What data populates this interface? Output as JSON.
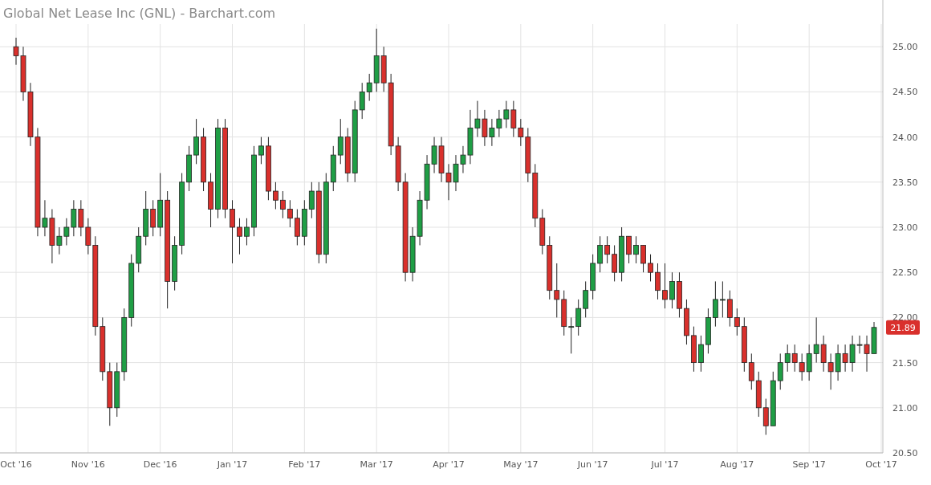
{
  "title": "Global Net Lease Inc (GNL) - Barchart.com",
  "last_price": {
    "label": "21.89",
    "color": "#d9302c"
  },
  "chart_data": {
    "type": "candlestick",
    "grid": true,
    "ylim": [
      20.5,
      25.5
    ],
    "categories": [
      "Oct '16",
      null,
      null,
      null,
      null,
      null,
      null,
      null,
      null,
      null,
      "Nov '16",
      null,
      null,
      null,
      null,
      null,
      null,
      null,
      null,
      null,
      "Dec '16",
      null,
      null,
      null,
      null,
      null,
      null,
      null,
      null,
      null,
      "Jan '17",
      null,
      null,
      null,
      null,
      null,
      null,
      null,
      null,
      null,
      "Feb '17",
      null,
      null,
      null,
      null,
      null,
      null,
      null,
      null,
      null,
      "Mar '17",
      null,
      null,
      null,
      null,
      null,
      null,
      null,
      null,
      null,
      "Apr '17",
      null,
      null,
      null,
      null,
      null,
      null,
      null,
      null,
      null,
      "May '17",
      null,
      null,
      null,
      null,
      null,
      null,
      null,
      null,
      null,
      "Jun '17",
      null,
      null,
      null,
      null,
      null,
      null,
      null,
      null,
      null,
      "Jul '17",
      null,
      null,
      null,
      null,
      null,
      null,
      null,
      null,
      null,
      "Aug '17",
      null,
      null,
      null,
      null,
      null,
      null,
      null,
      null,
      null,
      "Sep '17",
      null,
      null,
      null,
      null,
      null,
      null,
      null,
      null,
      null,
      "Oct '17"
    ],
    "yticks": [
      {
        "value": 20.5,
        "label": "20.50"
      },
      {
        "value": 21,
        "label": "21.00"
      },
      {
        "value": 21.5,
        "label": "21.50"
      },
      {
        "value": 22,
        "label": "22.00"
      },
      {
        "value": 22.5,
        "label": "22.50"
      },
      {
        "value": 23,
        "label": "23.00"
      },
      {
        "value": 23.5,
        "label": "23.50"
      },
      {
        "value": 24,
        "label": "24.00"
      },
      {
        "value": 24.5,
        "label": "24.50"
      },
      {
        "value": 25,
        "label": "25.00"
      }
    ],
    "ohlc": [
      [
        25.0,
        25.1,
        24.8,
        24.9
      ],
      [
        24.9,
        25.0,
        24.4,
        24.5
      ],
      [
        24.5,
        24.6,
        23.9,
        24.0
      ],
      [
        24.0,
        24.1,
        22.9,
        23.0
      ],
      [
        23.0,
        23.3,
        22.9,
        23.1
      ],
      [
        23.1,
        23.2,
        22.6,
        22.8
      ],
      [
        22.8,
        23.0,
        22.7,
        22.9
      ],
      [
        22.9,
        23.1,
        22.8,
        23.0
      ],
      [
        23.0,
        23.3,
        22.9,
        23.2
      ],
      [
        23.2,
        23.3,
        22.9,
        23.0
      ],
      [
        23.0,
        23.1,
        22.7,
        22.8
      ],
      [
        22.8,
        22.9,
        21.8,
        21.9
      ],
      [
        21.9,
        22.0,
        21.3,
        21.4
      ],
      [
        21.4,
        21.5,
        20.8,
        21.0
      ],
      [
        21.0,
        21.5,
        20.9,
        21.4
      ],
      [
        21.4,
        22.1,
        21.3,
        22.0
      ],
      [
        22.0,
        22.7,
        21.9,
        22.6
      ],
      [
        22.6,
        23.0,
        22.5,
        22.9
      ],
      [
        22.9,
        23.4,
        22.8,
        23.2
      ],
      [
        23.2,
        23.3,
        22.9,
        23.0
      ],
      [
        23.0,
        23.6,
        22.9,
        23.3
      ],
      [
        23.3,
        23.4,
        22.1,
        22.4
      ],
      [
        22.4,
        22.9,
        22.3,
        22.8
      ],
      [
        22.8,
        23.6,
        22.7,
        23.5
      ],
      [
        23.5,
        23.9,
        23.4,
        23.8
      ],
      [
        23.8,
        24.2,
        23.7,
        24.0
      ],
      [
        24.0,
        24.1,
        23.4,
        23.5
      ],
      [
        23.5,
        23.6,
        23.0,
        23.2
      ],
      [
        23.2,
        24.2,
        23.1,
        24.1
      ],
      [
        24.1,
        24.2,
        23.1,
        23.2
      ],
      [
        23.2,
        23.3,
        22.6,
        23.0
      ],
      [
        23.0,
        23.1,
        22.7,
        22.9
      ],
      [
        22.9,
        23.1,
        22.8,
        23.0
      ],
      [
        23.0,
        23.9,
        22.9,
        23.8
      ],
      [
        23.8,
        24.0,
        23.7,
        23.9
      ],
      [
        23.9,
        24.0,
        23.3,
        23.4
      ],
      [
        23.4,
        23.5,
        23.2,
        23.3
      ],
      [
        23.3,
        23.4,
        23.1,
        23.2
      ],
      [
        23.2,
        23.3,
        23.0,
        23.1
      ],
      [
        23.1,
        23.2,
        22.8,
        22.9
      ],
      [
        22.9,
        23.3,
        22.8,
        23.2
      ],
      [
        23.2,
        23.5,
        23.1,
        23.4
      ],
      [
        23.4,
        23.5,
        22.6,
        22.7
      ],
      [
        22.7,
        23.6,
        22.6,
        23.5
      ],
      [
        23.5,
        23.9,
        23.4,
        23.8
      ],
      [
        23.8,
        24.2,
        23.7,
        24.0
      ],
      [
        24.0,
        24.1,
        23.5,
        23.6
      ],
      [
        23.6,
        24.4,
        23.5,
        24.3
      ],
      [
        24.3,
        24.6,
        24.2,
        24.5
      ],
      [
        24.5,
        24.7,
        24.4,
        24.6
      ],
      [
        24.6,
        25.2,
        24.5,
        24.9
      ],
      [
        24.9,
        25.0,
        24.5,
        24.6
      ],
      [
        24.6,
        24.7,
        23.8,
        23.9
      ],
      [
        23.9,
        24.0,
        23.4,
        23.5
      ],
      [
        23.5,
        23.6,
        22.4,
        22.5
      ],
      [
        22.5,
        23.0,
        22.4,
        22.9
      ],
      [
        22.9,
        23.4,
        22.8,
        23.3
      ],
      [
        23.3,
        23.8,
        23.2,
        23.7
      ],
      [
        23.7,
        24.0,
        23.6,
        23.9
      ],
      [
        23.9,
        24.0,
        23.5,
        23.6
      ],
      [
        23.6,
        23.7,
        23.3,
        23.5
      ],
      [
        23.5,
        23.8,
        23.4,
        23.7
      ],
      [
        23.7,
        23.9,
        23.6,
        23.8
      ],
      [
        23.8,
        24.3,
        23.7,
        24.1
      ],
      [
        24.1,
        24.4,
        24.0,
        24.2
      ],
      [
        24.2,
        24.3,
        23.9,
        24.0
      ],
      [
        24.0,
        24.2,
        23.9,
        24.1
      ],
      [
        24.1,
        24.3,
        24.0,
        24.2
      ],
      [
        24.2,
        24.4,
        24.1,
        24.3
      ],
      [
        24.3,
        24.4,
        24.0,
        24.1
      ],
      [
        24.1,
        24.2,
        23.9,
        24.0
      ],
      [
        24.0,
        24.1,
        23.5,
        23.6
      ],
      [
        23.6,
        23.7,
        23.0,
        23.1
      ],
      [
        23.1,
        23.2,
        22.7,
        22.8
      ],
      [
        22.8,
        22.9,
        22.2,
        22.3
      ],
      [
        22.3,
        22.6,
        22.0,
        22.2
      ],
      [
        22.2,
        22.3,
        21.8,
        21.9
      ],
      [
        21.9,
        22.0,
        21.6,
        21.9
      ],
      [
        21.9,
        22.2,
        21.8,
        22.1
      ],
      [
        22.1,
        22.4,
        22.0,
        22.3
      ],
      [
        22.3,
        22.7,
        22.2,
        22.6
      ],
      [
        22.6,
        22.9,
        22.5,
        22.8
      ],
      [
        22.8,
        22.9,
        22.6,
        22.7
      ],
      [
        22.7,
        22.8,
        22.4,
        22.5
      ],
      [
        22.5,
        23.0,
        22.4,
        22.9
      ],
      [
        22.9,
        22.9,
        22.6,
        22.7
      ],
      [
        22.7,
        22.9,
        22.6,
        22.8
      ],
      [
        22.8,
        22.8,
        22.5,
        22.6
      ],
      [
        22.6,
        22.7,
        22.4,
        22.5
      ],
      [
        22.5,
        22.6,
        22.2,
        22.3
      ],
      [
        22.3,
        22.6,
        22.1,
        22.2
      ],
      [
        22.2,
        22.5,
        22.1,
        22.4
      ],
      [
        22.4,
        22.5,
        22.0,
        22.1
      ],
      [
        22.1,
        22.2,
        21.7,
        21.8
      ],
      [
        21.8,
        21.9,
        21.4,
        21.5
      ],
      [
        21.5,
        21.8,
        21.4,
        21.7
      ],
      [
        21.7,
        22.1,
        21.6,
        22.0
      ],
      [
        22.0,
        22.4,
        21.9,
        22.2
      ],
      [
        22.2,
        22.4,
        22.0,
        22.2
      ],
      [
        22.2,
        22.3,
        21.9,
        22.0
      ],
      [
        22.0,
        22.1,
        21.8,
        21.9
      ],
      [
        21.9,
        22.0,
        21.4,
        21.5
      ],
      [
        21.5,
        21.6,
        21.2,
        21.3
      ],
      [
        21.3,
        21.4,
        20.9,
        21.0
      ],
      [
        21.0,
        21.1,
        20.7,
        20.8
      ],
      [
        20.8,
        21.4,
        20.8,
        21.3
      ],
      [
        21.3,
        21.6,
        21.2,
        21.5
      ],
      [
        21.5,
        21.7,
        21.4,
        21.6
      ],
      [
        21.6,
        21.7,
        21.4,
        21.5
      ],
      [
        21.5,
        21.6,
        21.3,
        21.4
      ],
      [
        21.4,
        21.7,
        21.3,
        21.6
      ],
      [
        21.6,
        22.0,
        21.5,
        21.7
      ],
      [
        21.7,
        21.8,
        21.4,
        21.5
      ],
      [
        21.5,
        21.6,
        21.2,
        21.4
      ],
      [
        21.4,
        21.7,
        21.3,
        21.6
      ],
      [
        21.6,
        21.7,
        21.4,
        21.5
      ],
      [
        21.5,
        21.8,
        21.4,
        21.7
      ],
      [
        21.7,
        21.8,
        21.6,
        21.7
      ],
      [
        21.7,
        21.8,
        21.4,
        21.6
      ],
      [
        21.6,
        21.95,
        21.6,
        21.89
      ],
      null
    ]
  }
}
